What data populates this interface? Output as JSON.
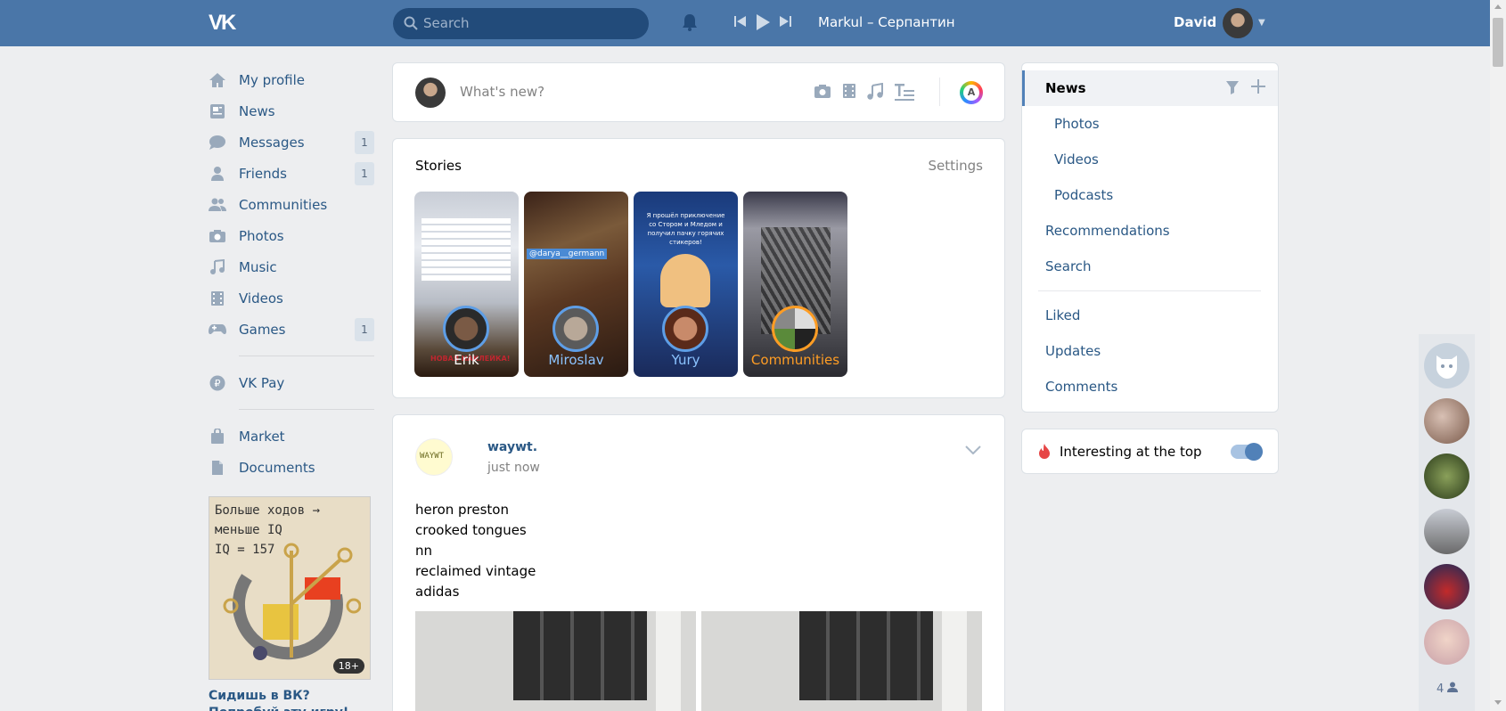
{
  "header": {
    "logo": "VK",
    "search_placeholder": "Search",
    "now_playing": "Markul – Серпантин",
    "user_name": "David"
  },
  "left_menu": [
    {
      "label": "My profile",
      "icon": "home-icon"
    },
    {
      "label": "News",
      "icon": "news-icon"
    },
    {
      "label": "Messages",
      "icon": "messages-icon",
      "count": "1"
    },
    {
      "label": "Friends",
      "icon": "friends-icon",
      "count": "1"
    },
    {
      "label": "Communities",
      "icon": "communities-icon"
    },
    {
      "label": "Photos",
      "icon": "camera-icon"
    },
    {
      "label": "Music",
      "icon": "music-icon"
    },
    {
      "label": "Videos",
      "icon": "video-icon"
    },
    {
      "label": "Games",
      "icon": "games-icon",
      "count": "1"
    }
  ],
  "left_menu_extra": {
    "vkpay": "VK Pay",
    "market": "Market",
    "documents": "Documents"
  },
  "ad": {
    "image_text_line1": "Больше ходов → меньше IQ",
    "image_text_line2": "IQ = 157",
    "age_badge": "18+",
    "caption": "Сидишь в ВК? Попробуй эту игру!"
  },
  "new_post": {
    "placeholder": "What's new?",
    "rainbow_letter": "A"
  },
  "stories": {
    "title": "Stories",
    "settings_label": "Settings",
    "items": [
      {
        "name": "Erik",
        "overlay": "НОВАЯ НАКЛЕЙКА!"
      },
      {
        "name": "Miroslav",
        "tag": "@darya__germann"
      },
      {
        "name": "Yury",
        "text": "Я прошёл приключение со Стором и Мледом и получил пачку горячих стикеров!"
      },
      {
        "name": "Communities"
      }
    ]
  },
  "post": {
    "author": "waywt.",
    "avatar_text": "WAYWT",
    "time": "just now",
    "lines": [
      "heron preston",
      "crooked tongues",
      "nn",
      "reclaimed vintage",
      "adidas"
    ]
  },
  "right_nav": {
    "items": [
      {
        "label": "News",
        "current": true
      },
      {
        "label": "Photos",
        "sub": true
      },
      {
        "label": "Videos",
        "sub": true
      },
      {
        "label": "Podcasts",
        "sub": true
      },
      {
        "label": "Recommendations"
      },
      {
        "label": "Search"
      },
      {
        "label": "Liked"
      },
      {
        "label": "Updates"
      },
      {
        "label": "Comments"
      }
    ]
  },
  "interesting": {
    "label": "Interesting at the top",
    "enabled": true
  },
  "friends_bar": {
    "count": "4"
  },
  "colors": {
    "header": "#4a76a8",
    "link": "#2a5885",
    "background": "#edeef0"
  }
}
